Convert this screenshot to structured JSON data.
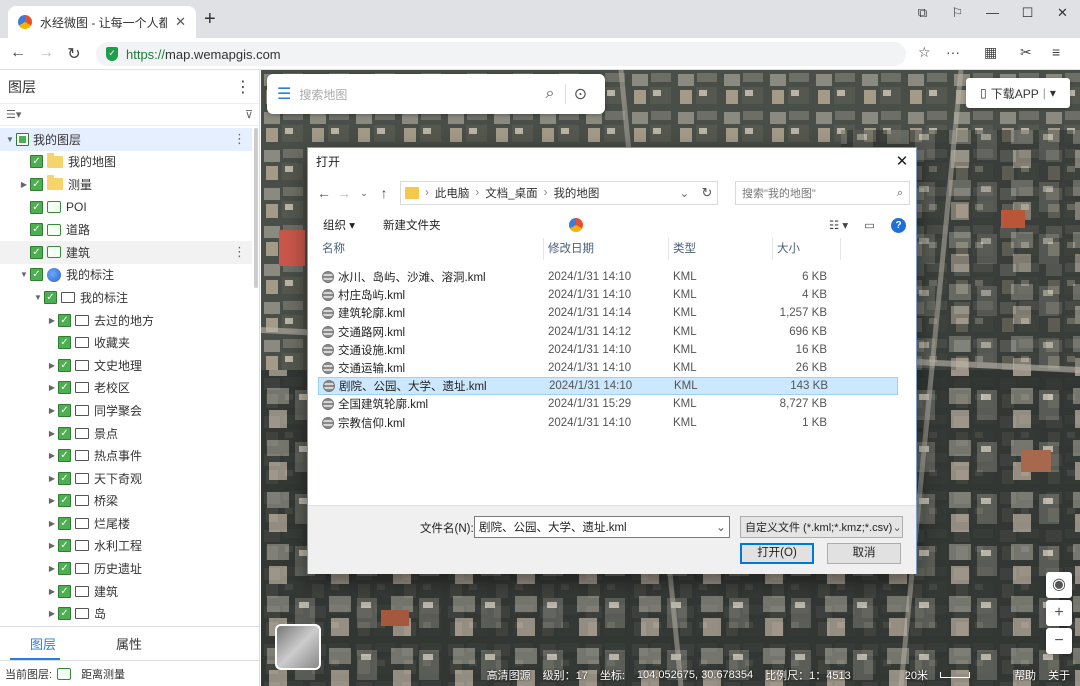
{
  "browser": {
    "tab_title": "水经微图 - 让每一个人都有自",
    "tab_close": "✕",
    "new_tab": "+",
    "window_controls": [
      "⧉",
      "⚐",
      "—",
      "☐",
      "✕"
    ],
    "url_scheme": "https://",
    "url_host": "map.wemapgis.com"
  },
  "layer_panel": {
    "title": "图层",
    "more": "⋮",
    "tree": [
      {
        "label": "我的图层",
        "level": 0,
        "arrow": "▼",
        "icon": "map",
        "check": "part",
        "selected": true,
        "dots": true
      },
      {
        "label": "我的地图",
        "level": 1,
        "arrow": "",
        "icon": "folder",
        "check": "on"
      },
      {
        "label": "测量",
        "level": 1,
        "arrow": "▶",
        "icon": "folder",
        "check": "on"
      },
      {
        "label": "POI",
        "level": 1,
        "arrow": "",
        "icon": "poi",
        "check": "on"
      },
      {
        "label": "道路",
        "level": 1,
        "arrow": "",
        "icon": "road",
        "check": "on"
      },
      {
        "label": "建筑",
        "level": 1,
        "arrow": "",
        "icon": "bld",
        "check": "on",
        "hover": true,
        "dots": true
      },
      {
        "label": "我的标注",
        "level": 1,
        "arrow": "▼",
        "icon": "globe",
        "check": "on"
      },
      {
        "label": "我的标注",
        "level": 2,
        "arrow": "▼",
        "icon": "gfold",
        "check": "on"
      },
      {
        "label": "去过的地方",
        "level": 3,
        "arrow": "▶",
        "icon": "gfold",
        "check": "on"
      },
      {
        "label": "收藏夹",
        "level": 3,
        "arrow": "",
        "icon": "gfold",
        "check": "on"
      },
      {
        "label": "文史地理",
        "level": 3,
        "arrow": "▶",
        "icon": "gfold",
        "check": "on"
      },
      {
        "label": "老校区",
        "level": 3,
        "arrow": "▶",
        "icon": "gfold",
        "check": "on"
      },
      {
        "label": "同学聚会",
        "level": 3,
        "arrow": "▶",
        "icon": "gfold",
        "check": "on"
      },
      {
        "label": "景点",
        "level": 3,
        "arrow": "▶",
        "icon": "gfold",
        "check": "on"
      },
      {
        "label": "热点事件",
        "level": 3,
        "arrow": "▶",
        "icon": "gfold",
        "check": "on"
      },
      {
        "label": "天下奇观",
        "level": 3,
        "arrow": "▶",
        "icon": "gfold",
        "check": "on"
      },
      {
        "label": "桥梁",
        "level": 3,
        "arrow": "▶",
        "icon": "gfold",
        "check": "on"
      },
      {
        "label": "烂尾楼",
        "level": 3,
        "arrow": "▶",
        "icon": "gfold",
        "check": "on"
      },
      {
        "label": "水利工程",
        "level": 3,
        "arrow": "▶",
        "icon": "gfold",
        "check": "on"
      },
      {
        "label": "历史遗址",
        "level": 3,
        "arrow": "▶",
        "icon": "gfold",
        "check": "on"
      },
      {
        "label": "建筑",
        "level": 3,
        "arrow": "▶",
        "icon": "gfold",
        "check": "on"
      },
      {
        "label": "岛",
        "level": 3,
        "arrow": "▶",
        "icon": "gfold",
        "check": "on"
      }
    ],
    "tab_layers": "图层",
    "tab_props": "属性",
    "status_label": "当前图层:",
    "status_value": "距离测量"
  },
  "map": {
    "search_placeholder": "搜索地图",
    "download_app": "下载APP",
    "status": {
      "imagery": "高清图源",
      "level": "级别：17",
      "coord_label": "坐标:",
      "coord": "104.052675, 30.678354",
      "scale": "比例尺：1：4513",
      "scalebar": "20米",
      "help": "帮助",
      "about": "关于"
    }
  },
  "dialog": {
    "title": "打开",
    "close": "✕",
    "breadcrumb": [
      "此电脑",
      "文档_桌面",
      "我的地图"
    ],
    "search_placeholder": "搜索\"我的地图\"",
    "organize": "组织 ▾",
    "new_folder": "新建文件夹",
    "columns": [
      "名称",
      "修改日期",
      "类型",
      "大小"
    ],
    "files": [
      {
        "name": "冰川、岛屿、沙滩、溶洞.kml",
        "date": "2024/1/31 14:10",
        "type": "KML",
        "size": "6 KB"
      },
      {
        "name": "村庄岛屿.kml",
        "date": "2024/1/31 14:10",
        "type": "KML",
        "size": "4 KB"
      },
      {
        "name": "建筑轮廓.kml",
        "date": "2024/1/31 14:14",
        "type": "KML",
        "size": "1,257 KB"
      },
      {
        "name": "交通路网.kml",
        "date": "2024/1/31 14:12",
        "type": "KML",
        "size": "696 KB"
      },
      {
        "name": "交通设施.kml",
        "date": "2024/1/31 14:10",
        "type": "KML",
        "size": "16 KB"
      },
      {
        "name": "交通运输.kml",
        "date": "2024/1/31 14:10",
        "type": "KML",
        "size": "26 KB"
      },
      {
        "name": "剧院、公园、大学、遗址.kml",
        "date": "2024/1/31 14:10",
        "type": "KML",
        "size": "143 KB",
        "selected": true
      },
      {
        "name": "全国建筑轮廓.kml",
        "date": "2024/1/31 15:29",
        "type": "KML",
        "size": "8,727 KB"
      },
      {
        "name": "宗教信仰.kml",
        "date": "2024/1/31 14:10",
        "type": "KML",
        "size": "1 KB"
      }
    ],
    "filename_label": "文件名(N):",
    "filename_value": "剧院、公园、大学、遗址.kml",
    "filetype": "自定义文件 (*.kml;*.kmz;*.csv)",
    "open_button": "打开(O)",
    "cancel_button": "取消"
  },
  "colors": {
    "accent": "#2a7de1",
    "check_green": "#4caf50",
    "selection": "#cce8ff"
  }
}
